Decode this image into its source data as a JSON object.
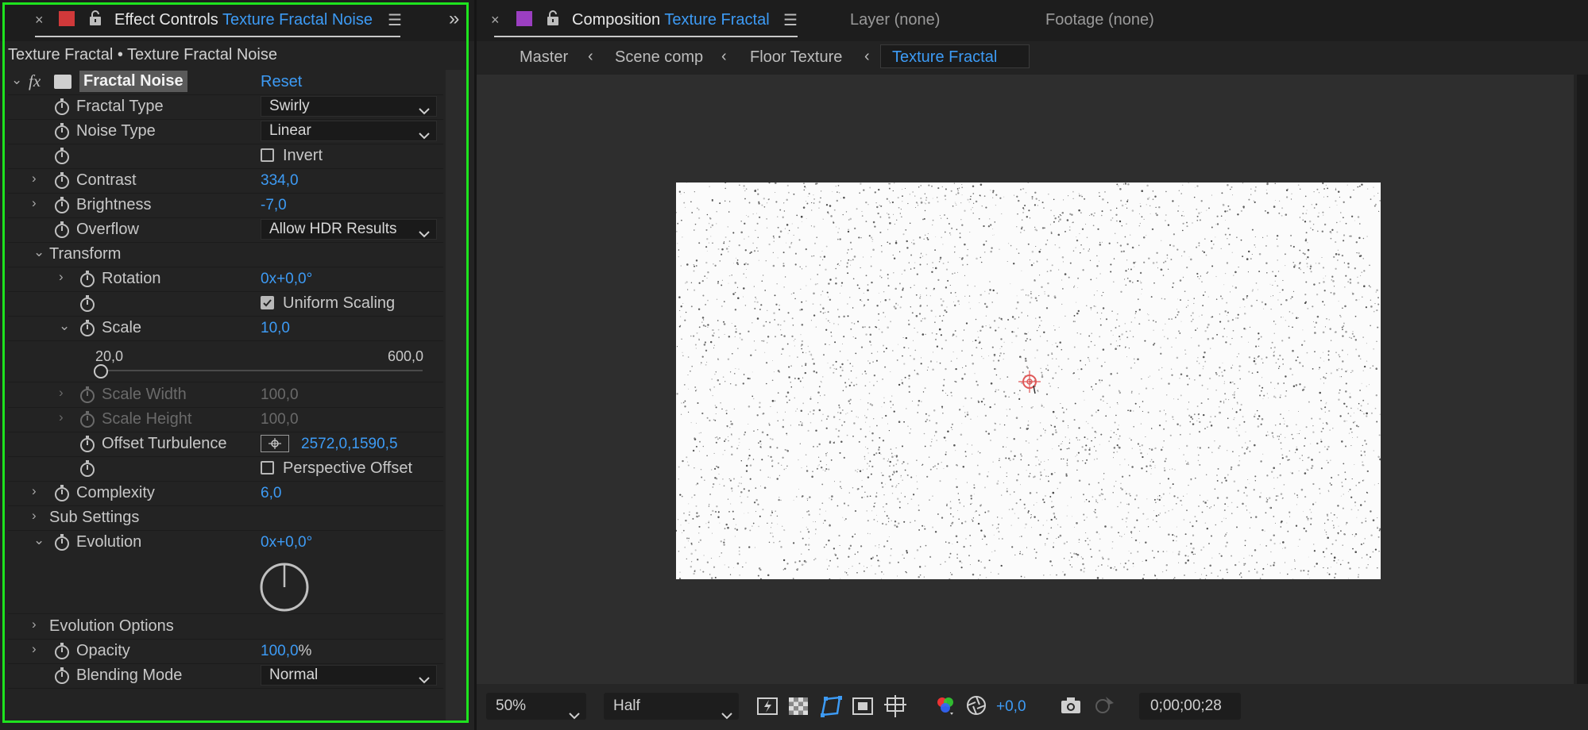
{
  "effect_panel": {
    "close": "×",
    "tab_prefix": "Effect Controls",
    "tab_layer": "Texture Fractal Noise",
    "expand_glyph": "»",
    "subtitle": "Texture Fractal • Texture Fractal Noise",
    "effect_name": "Fractal Noise",
    "reset": "Reset",
    "fx": "fx",
    "props": {
      "fractal_type": {
        "label": "Fractal Type",
        "value": "Swirly"
      },
      "noise_type": {
        "label": "Noise Type",
        "value": "Linear"
      },
      "invert": {
        "label": "Invert",
        "checked": false
      },
      "contrast": {
        "label": "Contrast",
        "value": "334,0"
      },
      "brightness": {
        "label": "Brightness",
        "value": "-7,0"
      },
      "overflow": {
        "label": "Overflow",
        "value": "Allow HDR Results"
      },
      "transform": {
        "label": "Transform"
      },
      "rotation": {
        "label": "Rotation",
        "value": "0x+0,0°"
      },
      "uniform_scaling": {
        "label": "Uniform Scaling",
        "checked": true
      },
      "scale": {
        "label": "Scale",
        "value": "10,0",
        "slider_min": "20,0",
        "slider_max": "600,0",
        "slider_fraction": 0.0
      },
      "scale_width": {
        "label": "Scale Width",
        "value": "100,0"
      },
      "scale_height": {
        "label": "Scale Height",
        "value": "100,0"
      },
      "offset_turbulence": {
        "label": "Offset Turbulence",
        "value": "2572,0,1590,5"
      },
      "perspective_offset": {
        "label": "Perspective Offset",
        "checked": false
      },
      "complexity": {
        "label": "Complexity",
        "value": "6,0"
      },
      "sub_settings": {
        "label": "Sub Settings"
      },
      "evolution": {
        "label": "Evolution",
        "value": "0x+0,0°"
      },
      "evolution_options": {
        "label": "Evolution Options"
      },
      "opacity": {
        "label": "Opacity",
        "value": "100,0",
        "unit": "%"
      },
      "blending_mode": {
        "label": "Blending Mode",
        "value": "Normal"
      }
    }
  },
  "composition": {
    "close": "×",
    "tab_prefix": "Composition",
    "tab_name": "Texture Fractal",
    "layer_tab": "Layer (none)",
    "footage_tab": "Footage (none)",
    "breadcrumbs": [
      "Master",
      "Scene comp",
      "Floor Texture",
      "Texture Fractal"
    ],
    "toolbar": {
      "zoom": "50%",
      "resolution": "Half",
      "exposure": "+0,0",
      "timecode": "0;00;00;28"
    }
  },
  "colors": {
    "highlight": "#1ee31e",
    "accent_blue": "#3d9bf5",
    "label_red": "#d0393a",
    "label_purple": "#9b3fc1"
  }
}
